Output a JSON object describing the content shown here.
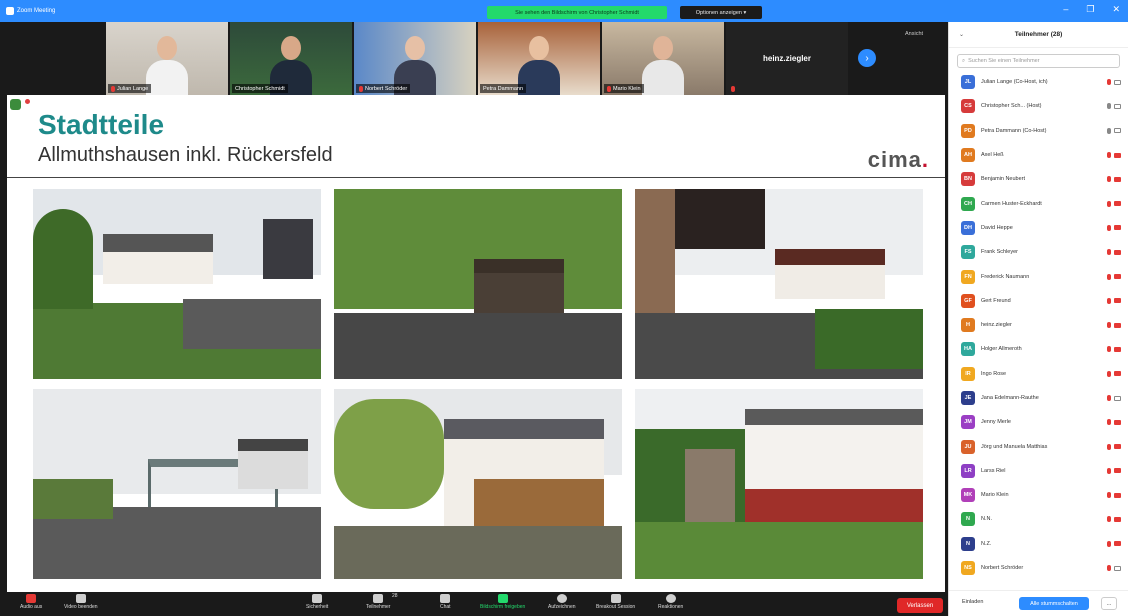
{
  "window": {
    "title": "Zoom Meeting"
  },
  "banner": {
    "sharing_text": "Sie sehen den Bildschirm von Christopher Schmidt",
    "view_options": "Optionen anzeigen ▾",
    "view_label": "Ansicht"
  },
  "thumbnails": [
    {
      "name": "Julian Lange",
      "muted": true
    },
    {
      "name": "Christopher Schmidt",
      "muted": false
    },
    {
      "name": "Norbert Schröder",
      "muted": true
    },
    {
      "name": "Petra Dammann",
      "muted": false
    },
    {
      "name": "Mario Klein",
      "muted": true
    },
    {
      "name": "heinz.ziegler",
      "muted": true
    }
  ],
  "slide": {
    "title": "Stadtteile",
    "subtitle": "Allmuthshausen inkl. Rückersfeld",
    "logo_main": "cima",
    "logo_dot": "."
  },
  "photos": [
    {
      "scene": "half-timbered-houses-street"
    },
    {
      "scene": "shelter-under-trees"
    },
    {
      "scene": "village-street-half-timbered"
    },
    {
      "scene": "bus-stop-shelter"
    },
    {
      "scene": "half-timbered-house-glass-extension"
    },
    {
      "scene": "house-with-stairs"
    }
  ],
  "toolbar": {
    "audio": "Audio aus",
    "video": "Video beenden",
    "security": "Sicherheit",
    "participants": "Teilnehmer",
    "participants_count": "28",
    "chat": "Chat",
    "share": "Bildschirm freigeben",
    "record": "Aufzeichnen",
    "breakout": "Breakout Session",
    "reactions": "Reaktionen",
    "end": "Verlassen"
  },
  "panel": {
    "title": "Teilnehmer (28)",
    "search_placeholder": "Suchen Sie einen Teilnehmer",
    "invite": "Einladen",
    "mute_all": "Alle stummschalten",
    "more": "..."
  },
  "participants": [
    {
      "initials": "JL",
      "name": "Julian Lange (Co-Host, ich)",
      "color": "#3a6fd8",
      "mic": false,
      "cam": true
    },
    {
      "initials": "CS",
      "name": "Christopher Sch...  (Host)",
      "color": "#d63b3b",
      "mic": true,
      "cam": true
    },
    {
      "initials": "PD",
      "name": "Petra Dammann (Co-Host)",
      "color": "#e07a1f",
      "mic": true,
      "cam": true
    },
    {
      "initials": "AH",
      "name": "Axel Heß",
      "color": "#e07a1f",
      "mic": false,
      "cam": false
    },
    {
      "initials": "BN",
      "name": "Benjamin Neubert",
      "color": "#d63b3b",
      "mic": false,
      "cam": false
    },
    {
      "initials": "CH",
      "name": "Carmen Huster-Eckhardt",
      "color": "#2fa84f",
      "mic": false,
      "cam": false
    },
    {
      "initials": "DH",
      "name": "David Heppe",
      "color": "#3a6fd8",
      "mic": false,
      "cam": false
    },
    {
      "initials": "FS",
      "name": "Frank Schleyer",
      "color": "#2fa89c",
      "mic": false,
      "cam": false
    },
    {
      "initials": "FN",
      "name": "Frederick Naumann",
      "color": "#f0a820",
      "mic": false,
      "cam": false
    },
    {
      "initials": "GF",
      "name": "Gert Freund",
      "color": "#e0501f",
      "mic": false,
      "cam": false
    },
    {
      "initials": "H",
      "name": "heinz.ziegler",
      "color": "#e07a1f",
      "mic": false,
      "cam": false
    },
    {
      "initials": "HA",
      "name": "Holger Allmeroth",
      "color": "#2fa89c",
      "mic": false,
      "cam": false
    },
    {
      "initials": "IR",
      "name": "Ingo Rose",
      "color": "#f0a820",
      "mic": false,
      "cam": false
    },
    {
      "initials": "JE",
      "name": "Jana Edelmann-Rauthe",
      "color": "#2d3e8c",
      "mic": false,
      "cam": true
    },
    {
      "initials": "JM",
      "name": "Jenny Merle",
      "color": "#9b3fc4",
      "mic": false,
      "cam": false
    },
    {
      "initials": "JU",
      "name": "Jörg und Manuela Matthias",
      "color": "#d9622b",
      "mic": false,
      "cam": false
    },
    {
      "initials": "LR",
      "name": "Larss Riel",
      "color": "#8e3fc4",
      "mic": false,
      "cam": false
    },
    {
      "initials": "MK",
      "name": "Mario Klein",
      "color": "#b03fb8",
      "mic": false,
      "cam": false
    },
    {
      "initials": "N",
      "name": "N.N.",
      "color": "#2fa84f",
      "mic": false,
      "cam": false
    },
    {
      "initials": "N",
      "name": "N.Z.",
      "color": "#2d3e8c",
      "mic": false,
      "cam": false
    },
    {
      "initials": "NS",
      "name": "Norbert Schröder",
      "color": "#f0a820",
      "mic": false,
      "cam": true
    }
  ]
}
